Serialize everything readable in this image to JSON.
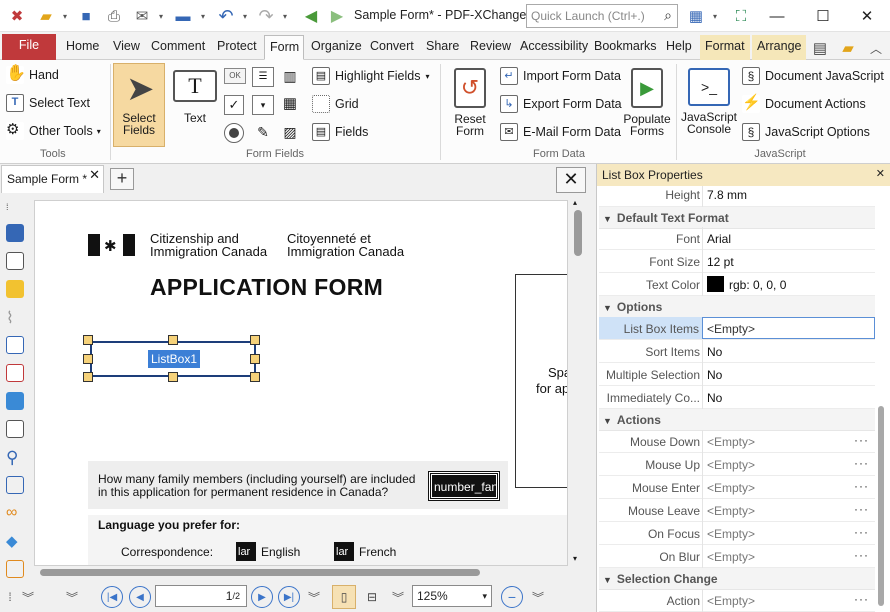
{
  "title_bar": {
    "doc_title": "Sample Form* - PDF-XChange ...",
    "quick_launch_placeholder": "Quick Launch (Ctrl+.)"
  },
  "tabs": [
    {
      "label": "File"
    },
    {
      "label": "Home"
    },
    {
      "label": "View"
    },
    {
      "label": "Comment"
    },
    {
      "label": "Protect"
    },
    {
      "label": "Form"
    },
    {
      "label": "Organize"
    },
    {
      "label": "Convert"
    },
    {
      "label": "Share"
    },
    {
      "label": "Review"
    },
    {
      "label": "Accessibility"
    },
    {
      "label": "Bookmarks"
    },
    {
      "label": "Help"
    },
    {
      "label": "Format"
    },
    {
      "label": "Arrange"
    }
  ],
  "ribbon": {
    "tools": {
      "hand": "Hand",
      "select_text": "Select Text",
      "other_tools": "Other Tools",
      "group": "Tools"
    },
    "form_fields": {
      "select_fields": "Select Fields",
      "text": "Text",
      "highlight_fields": "Highlight Fields",
      "grid": "Grid",
      "fields": "Fields",
      "group": "Form Fields",
      "btn_ok": "OK"
    },
    "form_data": {
      "import": "Import Form Data",
      "export": "Export Form Data",
      "email": "E-Mail Form Data",
      "reset": "Reset Form",
      "populate": "Populate Forms",
      "group": "Form Data"
    },
    "javascript": {
      "console": "JavaScript Console",
      "document_js": "Document JavaScript",
      "document_actions": "Document Actions",
      "js_options": "JavaScript Options",
      "group": "JavaScript"
    }
  },
  "document": {
    "tab_label": "Sample Form *",
    "dept_en_1": "Citizenship and",
    "dept_en_2": "Immigration Canada",
    "dept_fr_1": "Citoyenneté et",
    "dept_fr_2": "Immigration Canada",
    "heading": "APPLICATION FORM",
    "listbox_label": "ListBox1",
    "side_text_1": "Spa",
    "side_text_2": "for ap",
    "question_1": "How many family members (including yourself) are included",
    "question_2": "in this application for permanent residence in Canada?",
    "number_field": "number_fan",
    "lang_heading": "Language you prefer for:",
    "correspondence": "Correspondence:",
    "english": "English",
    "french": "French",
    "lang_box": "lar"
  },
  "status": {
    "page_current": "1",
    "page_total": "2",
    "zoom": "125%"
  },
  "panel": {
    "title": "List Box Properties",
    "rows": {
      "height": {
        "label": "Height",
        "value": "7.8 mm"
      },
      "cat_text_format": "Default Text Format",
      "font": {
        "label": "Font",
        "value": "Arial"
      },
      "font_size": {
        "label": "Font Size",
        "value": "12 pt"
      },
      "text_color": {
        "label": "Text Color",
        "value": "rgb: 0, 0, 0"
      },
      "cat_options": "Options",
      "list_items": {
        "label": "List Box Items",
        "value": "<Empty>"
      },
      "sort_items": {
        "label": "Sort Items",
        "value": "No"
      },
      "multi_sel": {
        "label": "Multiple Selection",
        "value": "No"
      },
      "immediately": {
        "label": "Immediately Co...",
        "value": "No"
      },
      "cat_actions": "Actions",
      "mouse_down": {
        "label": "Mouse Down",
        "value": "<Empty>"
      },
      "mouse_up": {
        "label": "Mouse Up",
        "value": "<Empty>"
      },
      "mouse_enter": {
        "label": "Mouse Enter",
        "value": "<Empty>"
      },
      "mouse_leave": {
        "label": "Mouse Leave",
        "value": "<Empty>"
      },
      "on_focus": {
        "label": "On Focus",
        "value": "<Empty>"
      },
      "on_blur": {
        "label": "On Blur",
        "value": "<Empty>"
      },
      "cat_selection": "Selection Change",
      "action": {
        "label": "Action",
        "value": "<Empty>"
      }
    }
  },
  "colors": {
    "accent": "#c0393b",
    "selection": "#3c7fd6",
    "panel_head": "#f6e8c1"
  }
}
